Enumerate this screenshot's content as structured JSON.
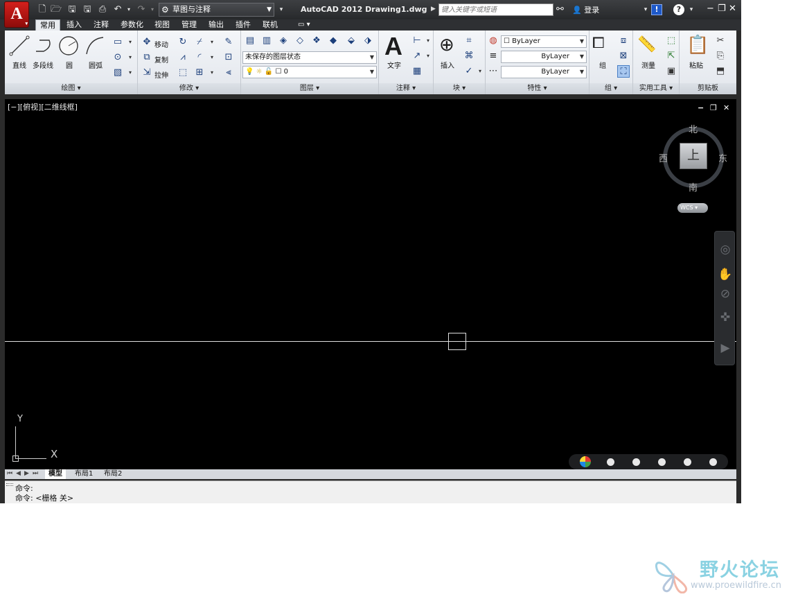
{
  "titlebar": {
    "workspace": "草图与注释",
    "title": "AutoCAD 2012    Drawing1.dwg",
    "search_placeholder": "键入关键字或短语",
    "login": "登录"
  },
  "ribbon_tabs": [
    "常用",
    "插入",
    "注释",
    "参数化",
    "视图",
    "管理",
    "输出",
    "插件",
    "联机"
  ],
  "panels": {
    "draw": {
      "title": "绘图 ▾",
      "tools": [
        "直线",
        "多段线",
        "圆",
        "圆弧"
      ]
    },
    "modify": {
      "title": "修改 ▾",
      "tools": [
        "移动",
        "复制",
        "拉伸"
      ]
    },
    "layers": {
      "title": "图层 ▾",
      "layer_state": "未保存的图层状态",
      "current_layer": "0"
    },
    "annotation": {
      "title": "注释 ▾",
      "text_tool": "文字"
    },
    "block": {
      "title": "块 ▾",
      "insert_tool": "插入"
    },
    "properties": {
      "title": "特性 ▾",
      "color": "ByLayer",
      "linetype": "ByLayer",
      "lineweight": "ByLayer"
    },
    "groups": {
      "title": "组 ▾",
      "group_tool": "组"
    },
    "utilities": {
      "title": "实用工具 ▾",
      "measure_tool": "测量"
    },
    "clipboard": {
      "title": "剪贴板",
      "paste_tool": "粘贴"
    }
  },
  "viewport": {
    "label": "[−][俯视][二维线框]",
    "viewcube": {
      "face": "上",
      "north": "北",
      "south": "南",
      "east": "东",
      "west": "西",
      "wcs": "WCS"
    },
    "ucs": {
      "x": "X",
      "y": "Y"
    }
  },
  "layout_tabs": [
    "模型",
    "布局1",
    "布局2"
  ],
  "command_line": {
    "line1": "命令:",
    "line2": "命令:  <栅格 关>"
  },
  "watermark": {
    "title": "野火论坛",
    "url": "www.proewildfire.cn"
  },
  "colors": {
    "canvas": "#000000",
    "ribbon_bg": "#e8ebef",
    "title_bg": "#2b2b2b",
    "accent_red": "#c8201c"
  }
}
